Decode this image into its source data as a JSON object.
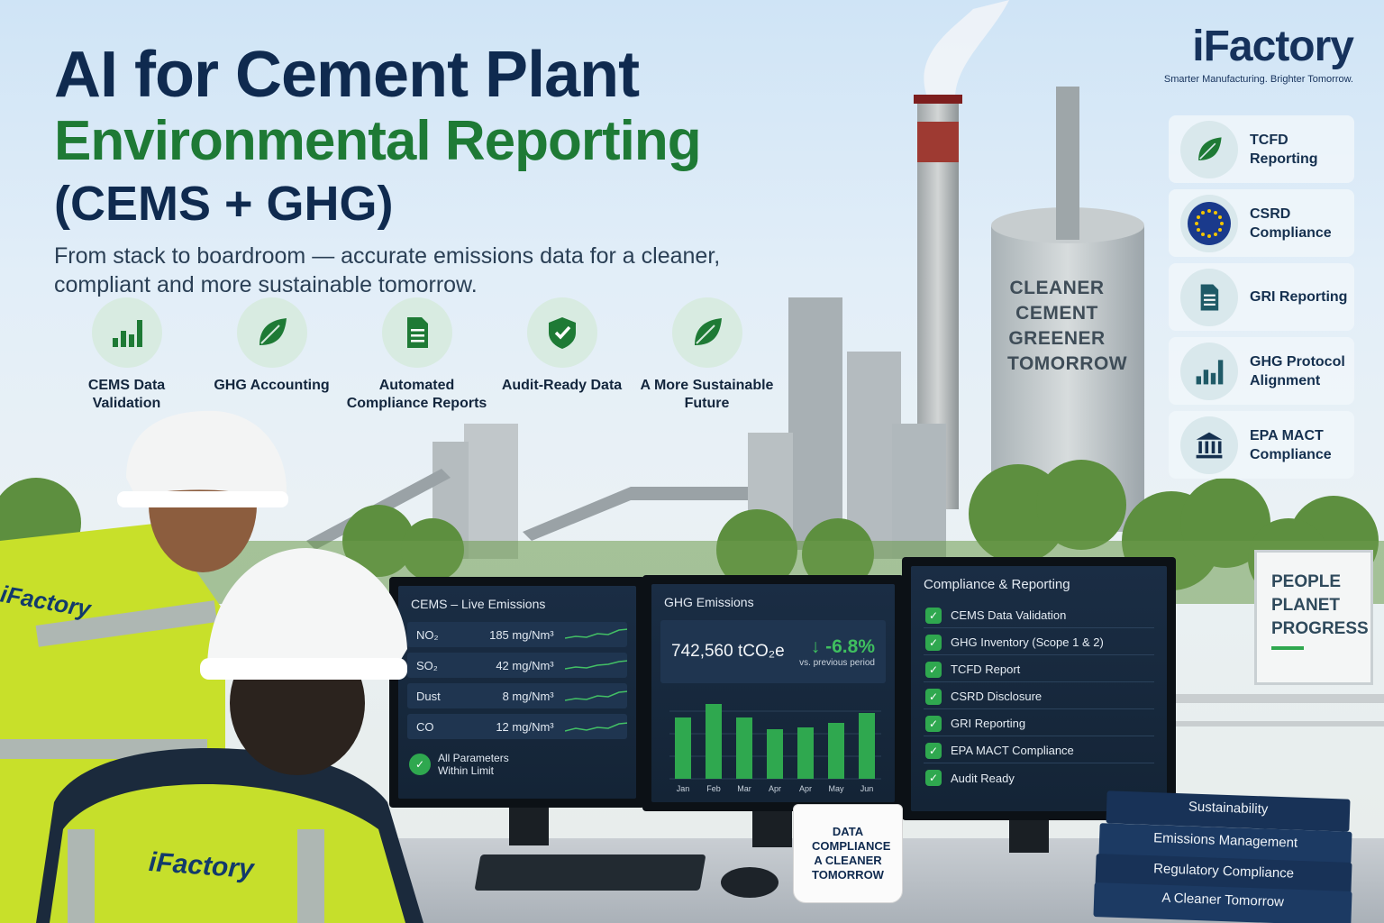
{
  "header": {
    "title_line1": "AI for Cement Plant",
    "title_line2": "Environmental Reporting",
    "title_line3": "(CEMS + GHG)",
    "subtitle": "From stack to boardroom — accurate emissions data for a cleaner, compliant and more sustainable tomorrow."
  },
  "brand": {
    "logo": "iFactory",
    "tagline": "Smarter Manufacturing. Brighter Tomorrow."
  },
  "features": [
    {
      "icon": "bar-chart-icon",
      "label": "CEMS Data Validation"
    },
    {
      "icon": "leaf-icon",
      "label": "GHG Accounting"
    },
    {
      "icon": "document-icon",
      "label": "Automated Compliance Reports"
    },
    {
      "icon": "shield-check-icon",
      "label": "Audit-Ready Data"
    },
    {
      "icon": "leaf-icon",
      "label": "A More Sustainable Future"
    }
  ],
  "side_cards": [
    {
      "icon": "leaf-icon",
      "label": "TCFD Reporting"
    },
    {
      "icon": "eu-flag-icon",
      "label": "CSRD Compliance"
    },
    {
      "icon": "document-icon",
      "label": "GRI Reporting"
    },
    {
      "icon": "bar-chart-icon",
      "label": "GHG Protocol Alignment"
    },
    {
      "icon": "government-building-icon",
      "label": "EPA MACT Compliance"
    }
  ],
  "silo_text": "CLEANER CEMENT GREENER TOMORROW",
  "sign_text": "PEOPLE PLANET PROGRESS",
  "cems": {
    "title": "CEMS – Live Emissions",
    "rows": [
      {
        "param": "NO₂",
        "value": "185 mg/Nm³"
      },
      {
        "param": "SO₂",
        "value": "42 mg/Nm³"
      },
      {
        "param": "Dust",
        "value": "8 mg/Nm³"
      },
      {
        "param": "CO",
        "value": "12 mg/Nm³"
      }
    ],
    "status": "All Parameters Within Limit"
  },
  "ghg": {
    "title": "GHG Emissions",
    "total": "742,560 tCO₂e",
    "change": "↓ -6.8%",
    "change_note": "vs. previous period",
    "months": [
      "Jan",
      "Feb",
      "Mar",
      "Apr",
      "Apr",
      "May",
      "Jun"
    ],
    "bar_values": [
      0.68,
      0.83,
      0.68,
      0.55,
      0.57,
      0.62,
      0.73
    ]
  },
  "compliance": {
    "title": "Compliance & Reporting",
    "items": [
      "CEMS Data Validation",
      "GHG Inventory (Scope 1 & 2)",
      "TCFD Report",
      "CSRD Disclosure",
      "GRI Reporting",
      "EPA MACT Compliance",
      "Audit Ready"
    ]
  },
  "mug_text": "DATA COMPLIANCE A CLEANER TOMORROW",
  "books": [
    "Sustainability",
    "Emissions Management",
    "Regulatory Compliance",
    "A Cleaner Tomorrow"
  ],
  "vest_text": "iFactory",
  "colors": {
    "navy": "#0f2a4f",
    "green": "#1e7a35",
    "accent_green": "#2fa84f"
  }
}
